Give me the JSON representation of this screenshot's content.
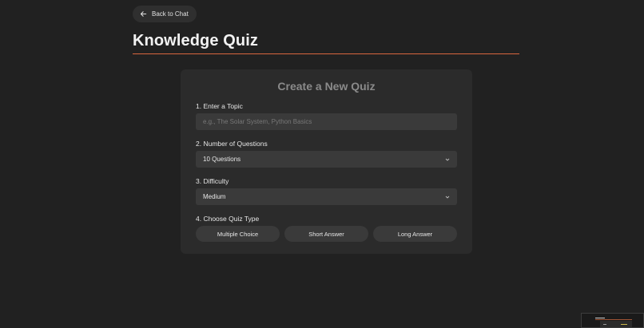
{
  "header": {
    "back_label": "Back to Chat",
    "title": "Knowledge Quiz"
  },
  "colors": {
    "accent": "#d9663f",
    "background": "#212121",
    "card": "#2b2b2b"
  },
  "form": {
    "heading": "Create a New Quiz",
    "topic": {
      "label": "1. Enter a Topic",
      "value": "",
      "placeholder": "e.g., The Solar System, Python Basics"
    },
    "questions": {
      "label": "2. Number of Questions",
      "selected": "10 Questions"
    },
    "difficulty": {
      "label": "3. Difficulty",
      "selected": "Medium"
    },
    "quiz_type": {
      "label": "4. Choose Quiz Type",
      "options": [
        "Multiple Choice",
        "Short Answer",
        "Long Answer"
      ]
    }
  },
  "icons": {
    "back": "arrow-left-icon",
    "select": "chevron-down-icon"
  }
}
